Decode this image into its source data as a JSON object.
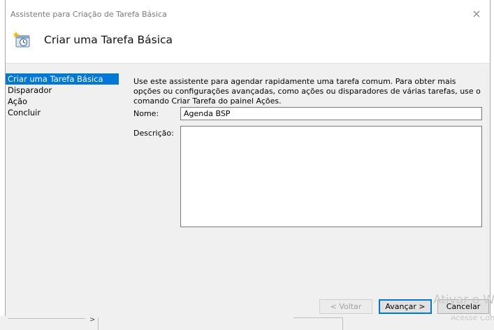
{
  "window": {
    "title": "Assistente para Criação de Tarefa Básica",
    "close_glyph": "×"
  },
  "header": {
    "title": "Criar uma Tarefa Básica",
    "icon": "task-scheduler-icon"
  },
  "sidebar": {
    "items": [
      {
        "label": "Criar uma Tarefa Básica",
        "active": true
      },
      {
        "label": "Disparador",
        "active": false
      },
      {
        "label": "Ação",
        "active": false
      },
      {
        "label": "Concluir",
        "active": false
      }
    ]
  },
  "main": {
    "intro": "Use este assistente para agendar rapidamente uma tarefa comum. Para obter mais opções ou configurações avançadas, como ações ou disparadores de várias tarefas, use o comando Criar Tarefa do painel Ações.",
    "name_label": "Nome:",
    "name_value": "Agenda BSP",
    "description_label": "Descrição:",
    "description_value": ""
  },
  "buttons": {
    "back": "< Voltar",
    "next": "Avançar >",
    "cancel": "Cancelar"
  },
  "watermark": {
    "line1": "Ativar o W",
    "line2": "Acesse Con"
  },
  "colors": {
    "accent": "#0078d7",
    "body_bg": "#f0f0f0"
  }
}
